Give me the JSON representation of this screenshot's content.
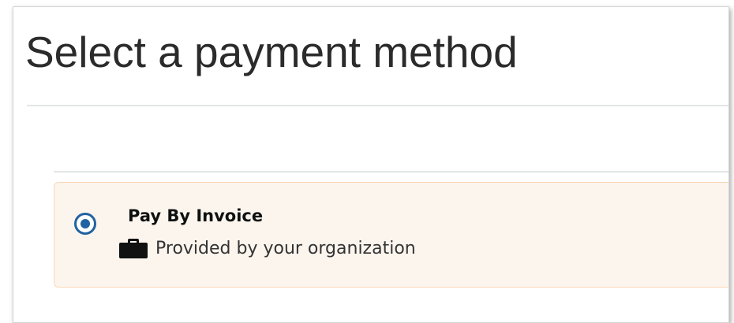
{
  "page": {
    "title": "Select a payment method"
  },
  "payment_options": [
    {
      "title": "Pay By Invoice",
      "description": "Provided by your organization",
      "selected": true,
      "icon": "briefcase-icon"
    }
  ],
  "colors": {
    "accent": "#2162a1",
    "option_background": "#fcf5ee",
    "option_border": "#fbd8b4",
    "title_text": "#2b2b2b",
    "divider": "#e3e6e6"
  }
}
